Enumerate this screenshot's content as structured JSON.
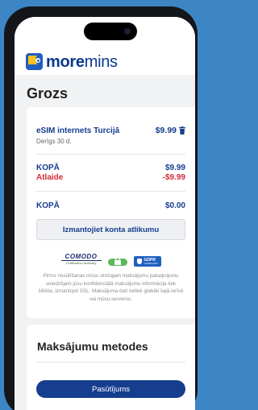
{
  "brand": {
    "name_bold": "more",
    "name_light": "mins"
  },
  "page": {
    "title": "Grozs"
  },
  "cart": {
    "item": {
      "name": "eSIM internets Turcijā",
      "price": "$9.99",
      "validity": "Derīgs 30 d."
    },
    "total_label": "KOPĀ",
    "total_value": "$9.99",
    "discount_label": "Atlaide",
    "discount_value": "-$9.99",
    "final_label": "KOPĀ",
    "final_value": "$0.00",
    "balance_button": "Izmantojiet konta atlikumu"
  },
  "trust": {
    "comodo_name": "COMODO",
    "comodo_sub": "Certification Authority",
    "gdpr_label": "GDPR",
    "gdpr_sub": "COMPLIANT",
    "note": "Pirms nosūtīšanas mūsu drošajam maksājumu pakalpojumu sniedzējam jūsu konfidenciālā maksājumu informācija tiek šifrēta, izmantojot SSL. Maksājuma dati netiek glabāti šajā ierīcē vai mūsu serveros."
  },
  "payment": {
    "title": "Maksājumu metodes",
    "order_button": "Pasūtījums"
  },
  "colors": {
    "background": "#3d86c6",
    "primary": "#163e8e",
    "discount": "#d22b3a"
  }
}
